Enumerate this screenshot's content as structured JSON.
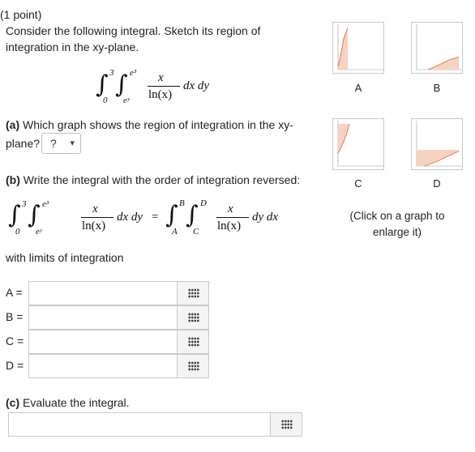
{
  "problem": {
    "points": "(1 point)",
    "intro_line1": "Consider the following integral. Sketch its region of",
    "intro_line2": "integration in the xy-plane."
  },
  "integral": {
    "outer_upper": "3",
    "outer_lower": "0",
    "inner_upper": "e³",
    "inner_lower": "eʸ",
    "numerator": "x",
    "denominator": "ln(x)",
    "differentials": "dx dy"
  },
  "part_a": {
    "label": "(a)",
    "line1": "Which graph shows the region of integration in the xy-",
    "line2": "plane?",
    "selected": "?",
    "arrow": "▾"
  },
  "part_b": {
    "label": "(b)",
    "text": "Write the integral with the order of integration reversed:",
    "equals": "=",
    "rhs_outer_upper": "B",
    "rhs_outer_lower": "A",
    "rhs_inner_upper": "D",
    "rhs_inner_lower": "C",
    "rhs_differentials": "dy dx",
    "with_limits": "with limits of integration"
  },
  "limits": [
    {
      "label": "A =",
      "value": ""
    },
    {
      "label": "B =",
      "value": ""
    },
    {
      "label": "C =",
      "value": ""
    },
    {
      "label": "D =",
      "value": ""
    }
  ],
  "part_c": {
    "label": "(c)",
    "text": "Evaluate the integral.",
    "value": ""
  },
  "graphs": {
    "labels": [
      "A",
      "B",
      "C",
      "D"
    ],
    "hint_line1": "(Click on a graph to",
    "hint_line2": "enlarge it)",
    "fill_color": "#f6d2c2",
    "curve_color": "#e06a4a"
  }
}
